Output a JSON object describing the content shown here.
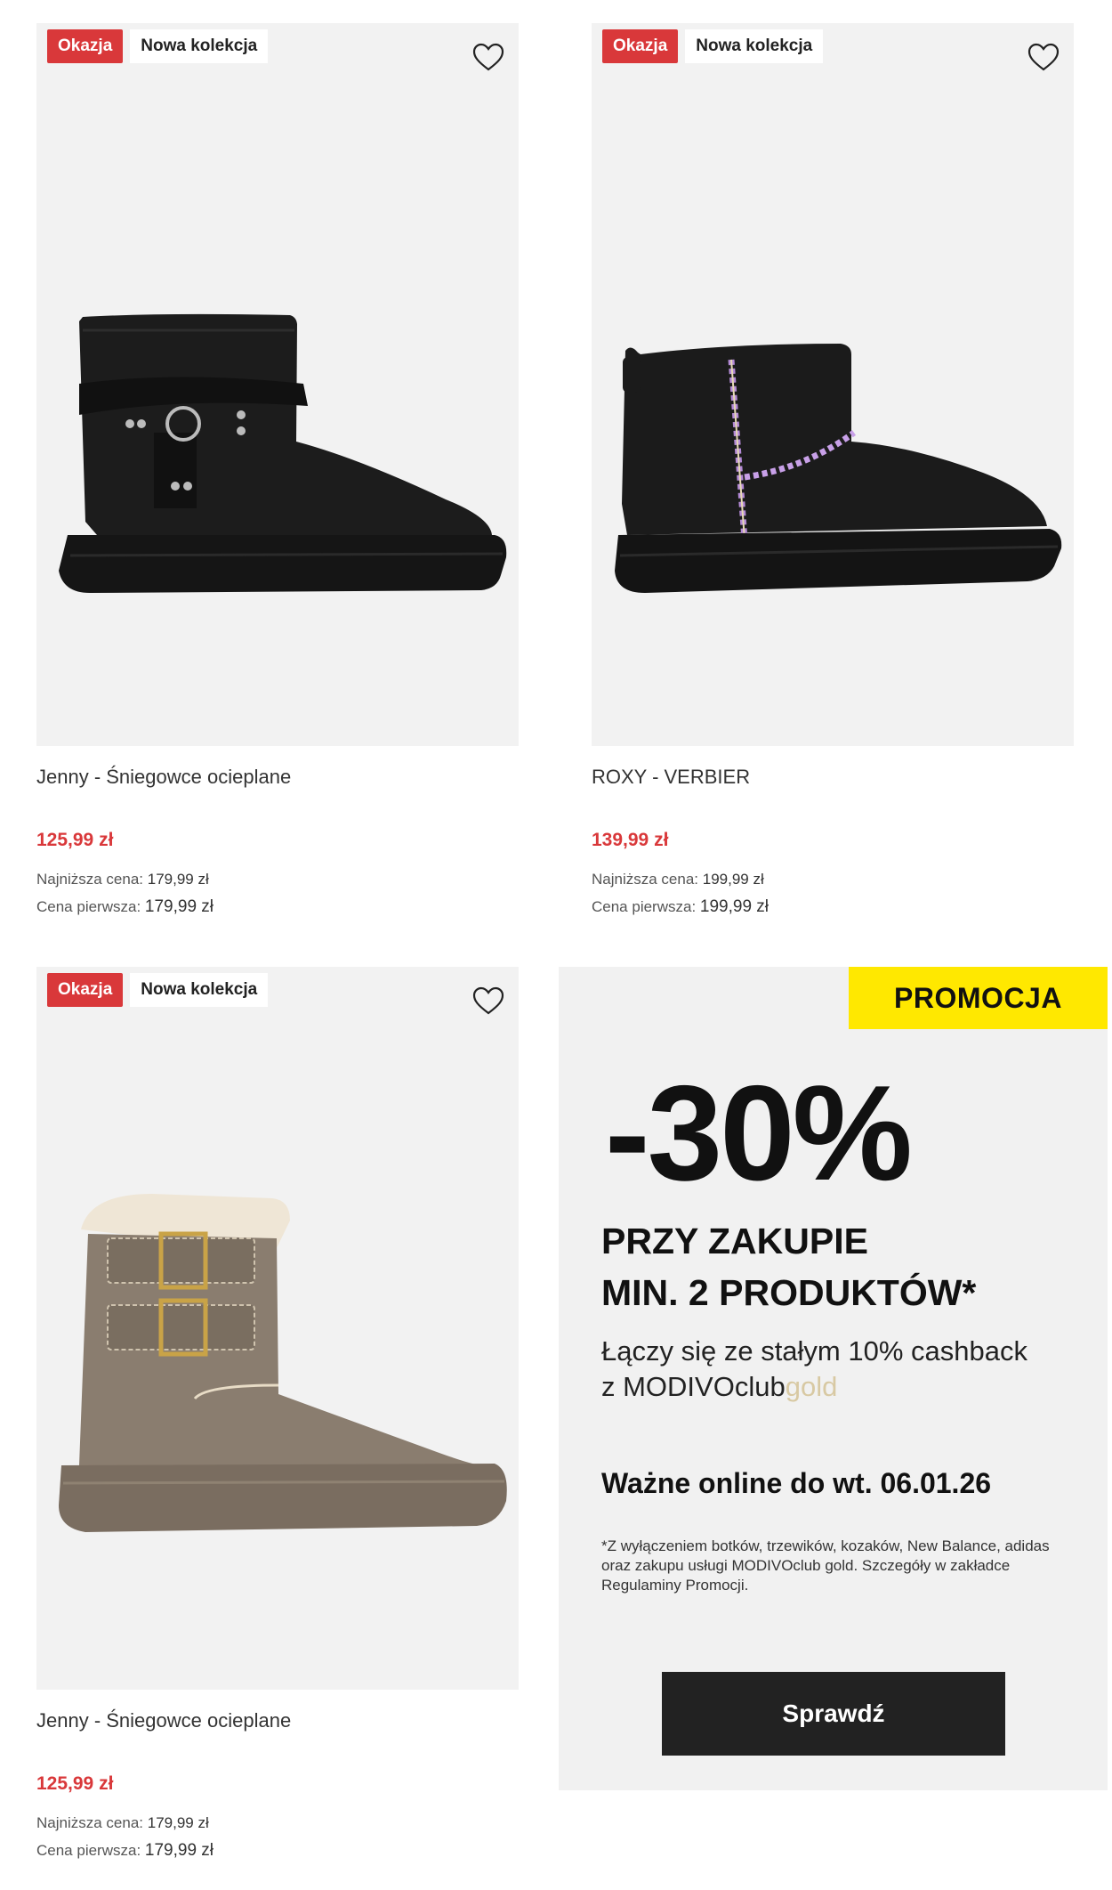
{
  "products": [
    {
      "badge_sale": "Okazja",
      "badge_new": "Nowa kolekcja",
      "name": "Jenny - Śniegowce ocieplane",
      "price": "125,99 zł",
      "lowest_label": "Najniższa cena:",
      "lowest_value": "179,99 zł",
      "first_label": "Cena pierwsza:",
      "first_value": "179,99 zł",
      "image_icon": "black-harness-boot"
    },
    {
      "badge_sale": "Okazja",
      "badge_new": "Nowa kolekcja",
      "name": "ROXY - VERBIER",
      "price": "139,99 zł",
      "lowest_label": "Najniższa cena:",
      "lowest_value": "199,99 zł",
      "first_label": "Cena pierwsza:",
      "first_value": "199,99 zł",
      "image_icon": "black-stitched-boot"
    },
    {
      "badge_sale": "Okazja",
      "badge_new": "Nowa kolekcja",
      "name": "Jenny - Śniegowce ocieplane",
      "price": "125,99 zł",
      "lowest_label": "Najniższa cena:",
      "lowest_value": "179,99 zł",
      "first_label": "Cena pierwsza:",
      "first_value": "179,99 zł",
      "image_icon": "taupe-buckle-boot"
    }
  ],
  "promo": {
    "label": "PROMOCJA",
    "discount": "-30%",
    "line1": "PRZY ZAKUPIE",
    "line2": "MIN. 2 PRODUKTÓW*",
    "sub1": "Łączy się ze stałym 10% cashback",
    "sub2_prefix": "z MODIVOclub",
    "sub2_gold": "gold",
    "valid": "Ważne online do wt. 06.01.26",
    "fine": "*Z wyłączeniem botków, trzewików, kozaków, New Balance, adidas oraz zakupu usługi MODIVOclub gold. Szczegóły w zakładce Regulaminy Promocji.",
    "button": "Sprawdź"
  },
  "colors": {
    "sale_red": "#d9383a",
    "promo_yellow": "#ffe800",
    "button_dark": "#222222",
    "gold": "#d8c9a3"
  }
}
